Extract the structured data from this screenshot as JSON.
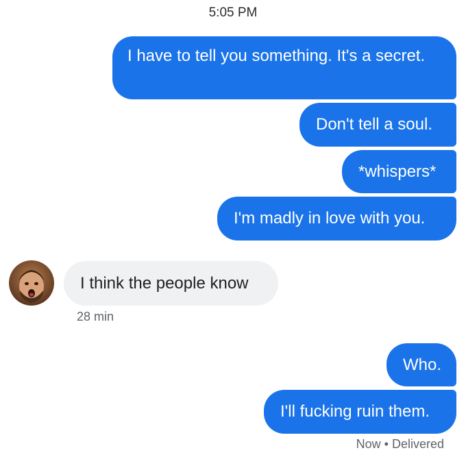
{
  "thread": {
    "timestamp": "5:05 PM",
    "messages": [
      {
        "text": "I have to tell you something. It's a secret."
      },
      {
        "text": "Don't tell a soul."
      },
      {
        "text": "*whispers*"
      },
      {
        "text": "I'm madly in love with you."
      },
      {
        "text": "I think the people know",
        "meta": "28 min"
      },
      {
        "text": "Who."
      },
      {
        "text": "I'll fucking ruin them."
      }
    ],
    "status": "Now • Delivered"
  },
  "colors": {
    "sent_bubble": "#1a73e8",
    "received_bubble": "#f0f1f3",
    "meta_text": "#5f6368"
  },
  "icons": {
    "avatar": "contact-avatar-photo"
  }
}
